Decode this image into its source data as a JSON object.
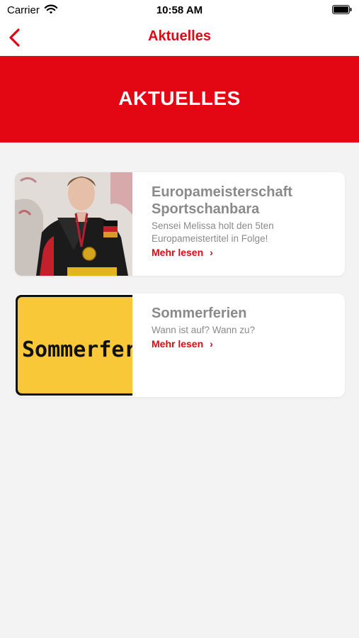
{
  "status_bar": {
    "carrier": "Carrier",
    "time": "10:58 AM"
  },
  "nav": {
    "title": "Aktuelles",
    "back_icon": "chevron-left-icon"
  },
  "hero": {
    "title": "AKTUELLES"
  },
  "articles": [
    {
      "title": "Europameisterschaft Sportschanbara",
      "description": "Sensei Melissa holt den 5ten Europameistertitel in Folge!",
      "link": "Mehr lesen",
      "link_icon": "chevron-right-icon"
    },
    {
      "title": "Sommerferien",
      "description": "Wann ist auf? Wann zu?",
      "link": "Mehr lesen",
      "link_icon": "chevron-right-icon",
      "image_sign_text": "Sommerferien"
    }
  ],
  "colors": {
    "brand_red": "#e30613",
    "text_gray": "#8a8a8a",
    "background": "#f3f3f3",
    "sign_yellow": "#f8c838"
  }
}
